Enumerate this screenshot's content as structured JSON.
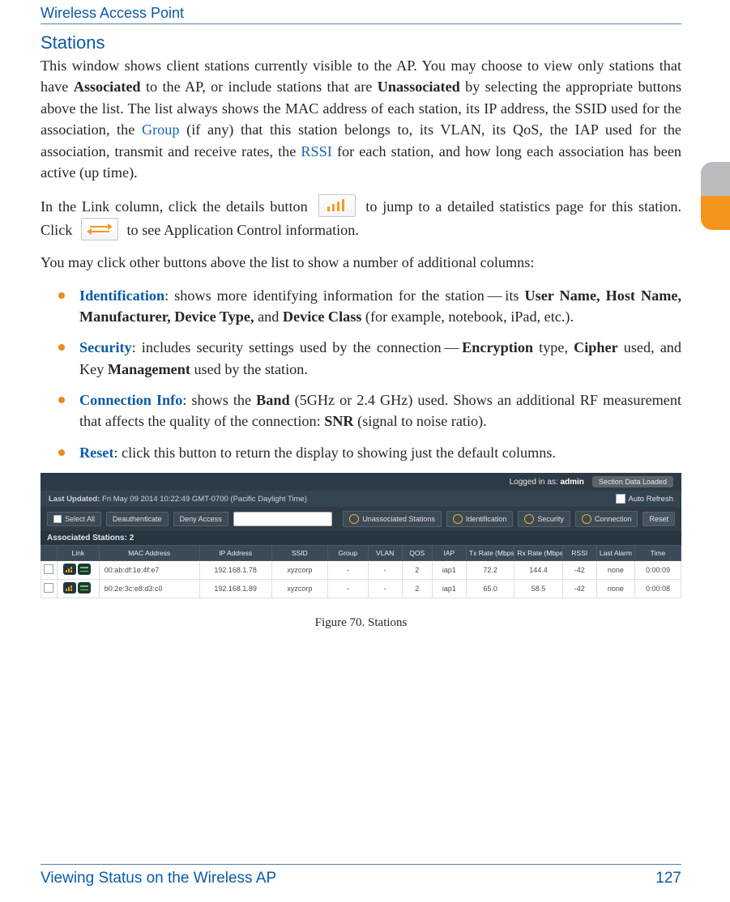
{
  "header": {
    "running": "Wireless Access Point"
  },
  "section": {
    "title": "Stations"
  },
  "para1": {
    "t1": "This window shows client stations currently visible to the AP. You may choose to view only stations that have ",
    "b1": "Associated",
    "t2": " to the AP, or include stations that are ",
    "b2": "Unassociated",
    "t3": " by selecting the appropriate buttons above the list. The list always shows the MAC address of each station, its IP address, the SSID used for the association, the ",
    "l1": "Group",
    "t4": " (if any) that this station belongs to, its VLAN, its QoS, the IAP used for the association, transmit and receive rates, the ",
    "l2": "RSSI",
    "t5": " for each station, and how long each association has been active (up time)."
  },
  "para2": {
    "t1": "In the Link column, click the details button",
    "t2": "to jump to a detailed statistics page for this station. Click",
    "t3": "to see Application Control information."
  },
  "para3": "You may click other buttons above the list to show a number of additional columns:",
  "bullets": {
    "identification": {
      "lead": "Identification",
      "t1": ": shows more identifying information for the station — its ",
      "b1": "User Name, Host Name, Manufacturer, Device Type,",
      "t2": " and ",
      "b2": "Device Class",
      "t3": " (for example, notebook, iPad, etc.)."
    },
    "security": {
      "lead": "Security",
      "t1": ": includes security settings used by the connection — ",
      "b1": "Encryption",
      "t2": " type, ",
      "b2": "Cipher",
      "t3": " used, and Key ",
      "b3": "Management",
      "t4": " used by the station."
    },
    "connection": {
      "lead": "Connection Info",
      "t1": ": shows the ",
      "b1": "Band",
      "t2": " (5GHz or 2.4 GHz) used. Shows an additional RF measurement that affects the quality of the connection: ",
      "b2": "SNR",
      "t3": " (signal to noise ratio)."
    },
    "reset": {
      "lead": "Reset",
      "t1": ": click this button to return the display to showing just the default columns."
    }
  },
  "figure": {
    "login_label": "Logged in as:",
    "login_user": "admin",
    "pill": "Section Data Loaded",
    "updated_label": "Last Updated:",
    "updated_value": "Fri May 09 2014 10:22:49 GMT-0700 (Pacific Daylight Time)",
    "auto_refresh": "Auto Refresh",
    "toolbar": {
      "select_all": "Select All",
      "deauth": "Deauthenticate",
      "deny": "Deny Access",
      "unassoc": "Unassociated Stations",
      "ident": "Identification",
      "security": "Security",
      "connection": "Connection",
      "reset": "Reset"
    },
    "assoc_header": "Associated Stations: 2",
    "columns": [
      "",
      "Link",
      "MAC Address",
      "IP Address",
      "SSID",
      "Group",
      "VLAN",
      "QOS",
      "IAP",
      "Tx Rate (Mbps)",
      "Rx Rate (Mbps)",
      "RSSI",
      "Last Alarm",
      "Time"
    ],
    "rows": [
      {
        "cb": "",
        "mac": "00:ab:df:1e:4f:e7",
        "ip": "192.168.1.78",
        "ssid": "xyzcorp",
        "group": "-",
        "vlan": "-",
        "qos": "2",
        "iap": "iap1",
        "tx": "72.2",
        "rx": "144.4",
        "rssi": "-42",
        "alarm": "none",
        "time": "0:00:09"
      },
      {
        "cb": "",
        "mac": "b0:2e:3c:e8:d3:c0",
        "ip": "192.168.1.89",
        "ssid": "xyzcorp",
        "group": "-",
        "vlan": "-",
        "qos": "2",
        "iap": "iap1",
        "tx": "65.0",
        "rx": "58.5",
        "rssi": "-42",
        "alarm": "none",
        "time": "0:00:08"
      }
    ],
    "caption": "Figure 70. Stations"
  },
  "footer": {
    "left": "Viewing Status on the Wireless AP",
    "page": "127"
  }
}
